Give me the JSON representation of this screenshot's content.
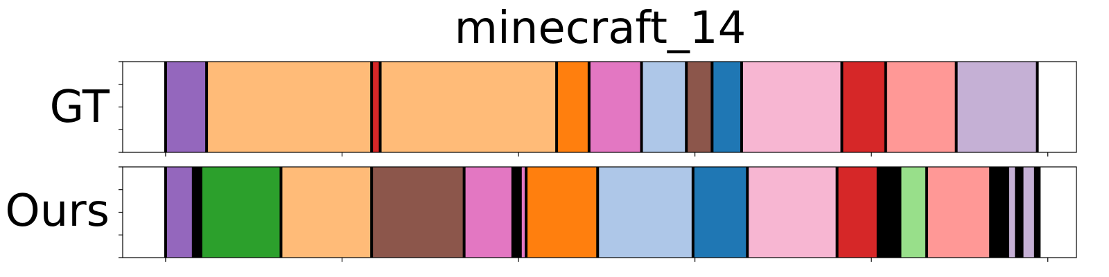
{
  "chart_data": {
    "type": "segmentation",
    "title": "minecraft_14",
    "x_range": [
      0,
      1
    ],
    "colors": {
      "white": "#ffffff",
      "black": "#000000",
      "purple": "#9467bd",
      "lightorange": "#ffbb78",
      "red": "#d62728",
      "orange": "#ff7f0e",
      "pink": "#e377c2",
      "lightblue": "#aec7e8",
      "brown": "#8c564b",
      "blue": "#1f77b4",
      "lightpink": "#f7b6d2",
      "salmon": "#ff9896",
      "lavender": "#c5b0d5",
      "green": "#2ca02c",
      "lightgreen": "#98df8a"
    },
    "rows": [
      {
        "label": "GT",
        "segments": [
          {
            "start": 0.0,
            "end": 0.045,
            "color": "white"
          },
          {
            "start": 0.045,
            "end": 0.088,
            "color": "purple"
          },
          {
            "start": 0.088,
            "end": 0.261,
            "color": "lightorange"
          },
          {
            "start": 0.261,
            "end": 0.27,
            "color": "red"
          },
          {
            "start": 0.27,
            "end": 0.455,
            "color": "lightorange"
          },
          {
            "start": 0.455,
            "end": 0.489,
            "color": "orange"
          },
          {
            "start": 0.489,
            "end": 0.544,
            "color": "pink"
          },
          {
            "start": 0.544,
            "end": 0.591,
            "color": "lightblue"
          },
          {
            "start": 0.591,
            "end": 0.618,
            "color": "brown"
          },
          {
            "start": 0.618,
            "end": 0.649,
            "color": "blue"
          },
          {
            "start": 0.649,
            "end": 0.754,
            "color": "lightpink"
          },
          {
            "start": 0.754,
            "end": 0.8,
            "color": "red"
          },
          {
            "start": 0.8,
            "end": 0.874,
            "color": "salmon"
          },
          {
            "start": 0.874,
            "end": 0.959,
            "color": "lavender"
          },
          {
            "start": 0.959,
            "end": 1.0,
            "color": "white"
          }
        ]
      },
      {
        "label": "Ours",
        "segments": [
          {
            "start": 0.0,
            "end": 0.045,
            "color": "white"
          },
          {
            "start": 0.045,
            "end": 0.074,
            "color": "purple"
          },
          {
            "start": 0.074,
            "end": 0.082,
            "color": "black"
          },
          {
            "start": 0.082,
            "end": 0.166,
            "color": "green"
          },
          {
            "start": 0.166,
            "end": 0.261,
            "color": "lightorange"
          },
          {
            "start": 0.261,
            "end": 0.358,
            "color": "brown"
          },
          {
            "start": 0.358,
            "end": 0.409,
            "color": "pink"
          },
          {
            "start": 0.409,
            "end": 0.417,
            "color": "black"
          },
          {
            "start": 0.417,
            "end": 0.423,
            "color": "pink"
          },
          {
            "start": 0.423,
            "end": 0.498,
            "color": "orange"
          },
          {
            "start": 0.498,
            "end": 0.598,
            "color": "lightblue"
          },
          {
            "start": 0.598,
            "end": 0.655,
            "color": "blue"
          },
          {
            "start": 0.655,
            "end": 0.749,
            "color": "lightpink"
          },
          {
            "start": 0.749,
            "end": 0.792,
            "color": "red"
          },
          {
            "start": 0.792,
            "end": 0.815,
            "color": "black"
          },
          {
            "start": 0.815,
            "end": 0.843,
            "color": "lightgreen"
          },
          {
            "start": 0.843,
            "end": 0.91,
            "color": "salmon"
          },
          {
            "start": 0.91,
            "end": 0.928,
            "color": "black"
          },
          {
            "start": 0.928,
            "end": 0.937,
            "color": "lavender"
          },
          {
            "start": 0.937,
            "end": 0.943,
            "color": "black"
          },
          {
            "start": 0.943,
            "end": 0.957,
            "color": "lavender"
          },
          {
            "start": 0.957,
            "end": 0.961,
            "color": "black"
          },
          {
            "start": 0.961,
            "end": 1.0,
            "color": "white"
          }
        ]
      }
    ],
    "x_ticks": [
      0.045,
      0.23,
      0.415,
      0.6,
      0.785,
      0.97
    ],
    "y_ticks_per_row": 5
  }
}
